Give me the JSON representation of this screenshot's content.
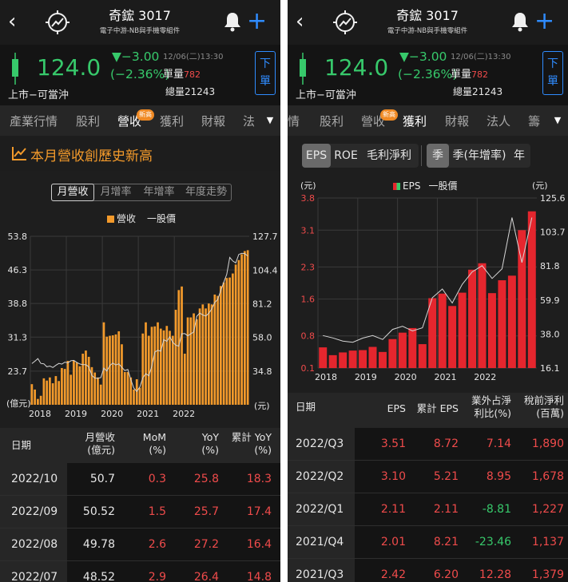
{
  "common": {
    "stock_title": "奇鋐 3017",
    "stock_subtitle": "電子中游-NB與手機零組件",
    "price": "124.0",
    "change": "▼−3.00",
    "change_pct": "(−2.36%)",
    "quote_time": "12/06(二)13:30",
    "unit_volume_label": "單量",
    "unit_volume": "782",
    "total_volume": "總量21243",
    "market": "上市−可當沖",
    "order_label": "下單",
    "icons": {
      "back": "back-chevron-icon",
      "logo": "trend-logo-icon",
      "bell": "bell-icon",
      "add": "plus-icon",
      "more": "dropdown-triangle-icon"
    },
    "colors": {
      "up": "#ef4b4b",
      "down": "#37c96b",
      "accent": "#f39a2b",
      "link": "#2f8cff"
    }
  },
  "left": {
    "tabs": [
      {
        "label": "產業行情"
      },
      {
        "label": "股利"
      },
      {
        "label": "營收",
        "badge": "新高",
        "active": true
      },
      {
        "label": "獲利"
      },
      {
        "label": "財報"
      },
      {
        "label": "法"
      }
    ],
    "banner": "本月營收創歷史新高",
    "segments": [
      "月營收",
      "月增率",
      "年增率",
      "年度走勢"
    ],
    "legend": {
      "bars": "營收",
      "line": "一股價"
    },
    "axis": {
      "left_ticks": [
        "53.8",
        "46.3",
        "38.8",
        "31.3",
        "23.7"
      ],
      "right_ticks": [
        "127.7",
        "104.4",
        "81.2",
        "58.0",
        "34.8"
      ],
      "left_unit": "(億元)",
      "right_unit": "(元)",
      "x_ticks": [
        "2018",
        "2019",
        "2020",
        "2021",
        "2022"
      ]
    },
    "table_headers": [
      "日期",
      "月營收\n(億元)",
      "MoM\n(%)",
      "YoY\n(%)",
      "累計 YoY\n(%)"
    ],
    "rows": [
      [
        "2022/10",
        "50.7",
        "0.3",
        "25.8",
        "18.3"
      ],
      [
        "2022/09",
        "50.52",
        "1.5",
        "25.7",
        "17.4"
      ],
      [
        "2022/08",
        "49.78",
        "2.6",
        "27.2",
        "16.4"
      ],
      [
        "2022/07",
        "48.52",
        "2.9",
        "26.4",
        "14.8"
      ]
    ]
  },
  "right": {
    "tabs": [
      {
        "label": "情"
      },
      {
        "label": "股利"
      },
      {
        "label": "營收",
        "badge": "新高"
      },
      {
        "label": "獲利",
        "active": true
      },
      {
        "label": "財報"
      },
      {
        "label": "法人"
      },
      {
        "label": "籌"
      }
    ],
    "seg_a": [
      "EPS",
      "ROE",
      "毛利淨利"
    ],
    "seg_b": [
      "季",
      "季(年增率)",
      "年"
    ],
    "legend": {
      "bars": "EPS",
      "line": "一股價"
    },
    "axis": {
      "left_unit": "(元)",
      "right_unit": "(元)",
      "left_ticks": [
        "3.8",
        "3.1",
        "2.3",
        "1.6",
        "0.8",
        "0.1"
      ],
      "right_ticks": [
        "125.6",
        "103.7",
        "81.8",
        "59.9",
        "38.0",
        "16.1"
      ],
      "x_ticks": [
        "2018",
        "2019",
        "2020",
        "2021",
        "2022"
      ]
    },
    "table_headers": [
      "日期",
      "EPS",
      "累計 EPS",
      "業外占淨\n利比(%)",
      "稅前淨利\n(百萬)"
    ],
    "rows": [
      [
        "2022/Q3",
        "3.51",
        "8.72",
        "7.14",
        "1,890"
      ],
      [
        "2022/Q2",
        "3.10",
        "5.21",
        "8.95",
        "1,678"
      ],
      [
        "2022/Q1",
        "2.11",
        "2.11",
        "-8.81",
        "1,227"
      ],
      [
        "2021/Q4",
        "2.01",
        "8.21",
        "-23.46",
        "1,137"
      ],
      [
        "2021/Q3",
        "2.42",
        "6.20",
        "12.28",
        "1,379"
      ]
    ]
  },
  "chart_data": [
    {
      "type": "bar",
      "title": "月營收",
      "ylabel": "(億元)",
      "y2label": "(元)",
      "ylim": [
        16.2,
        53.8
      ],
      "y2lim": [
        11.6,
        127.7
      ],
      "x_ticks": [
        "2018",
        "2019",
        "2020",
        "2021",
        "2022"
      ],
      "series": [
        {
          "name": "營收",
          "values": [
            20.8,
            19.6,
            17.5,
            18.2,
            22.1,
            21.6,
            22.3,
            21.0,
            22.6,
            21.5,
            24.4,
            24.2,
            26.0,
            22.9,
            26.0,
            25.6,
            24.8,
            27.6,
            28.3,
            26.9,
            24.6,
            23.4,
            22.3,
            20.7,
            34.6,
            31.4,
            31.6,
            31.7,
            31.9,
            32.6,
            29.7,
            23.5,
            23.5,
            22.3,
            19.6,
            21.9,
            20.0,
            32.1,
            34.6,
            31.6,
            33.6,
            33.7,
            34.6,
            33.2,
            32.8,
            33.8,
            32.7,
            31.6,
            37.4,
            41.8,
            42.6,
            27.6,
            35.7,
            35.7,
            36.6,
            35.3,
            37.7,
            38.6,
            37.7,
            38.8,
            38.6,
            40.8,
            40.5,
            42.7,
            43.5,
            44.5,
            44.6,
            45.5,
            47.5,
            48.5,
            49.8,
            50.5,
            50.7
          ]
        },
        {
          "name": "一股價",
          "values": [
            40.0,
            41.6,
            43.4,
            40.1,
            39.8,
            37.8,
            38.3,
            37.3,
            38.8,
            40.1,
            39.6,
            41.0,
            40.5,
            41.9,
            42.2,
            40.8,
            39.7,
            39.2,
            39.2,
            37.8,
            31.9,
            30.0,
            29.8,
            30.3,
            36.9,
            34.8,
            38.6,
            40.4,
            39.0,
            39.8,
            37.4,
            35.2,
            35.9,
            29.0,
            23.1,
            20.8,
            23.8,
            30.2,
            33.0,
            31.6,
            38.1,
            47.9,
            49.1,
            48.5,
            56.5,
            55.3,
            58.4,
            54.7,
            52.7,
            52.0,
            60.5,
            60.7,
            59.1,
            60.5,
            61.8,
            72.6,
            74.8,
            73.5,
            72.8,
            74.6,
            77.7,
            82.1,
            84.2,
            90.3,
            96.0,
            101.4,
            113.2,
            110.7,
            109.4,
            115.2,
            116.0,
            115.8,
            114.1
          ]
        }
      ]
    },
    {
      "type": "bar",
      "title": "EPS",
      "ylabel": "(元)",
      "y2label": "(元)",
      "ylim": [
        0.1,
        3.8
      ],
      "y2lim": [
        16.1,
        125.6
      ],
      "x_ticks": [
        "2018",
        "2019",
        "2020",
        "2021",
        "2022"
      ],
      "series": [
        {
          "name": "EPS",
          "values": [
            0.55,
            0.38,
            0.44,
            0.48,
            0.49,
            0.56,
            0.45,
            0.73,
            0.87,
            0.97,
            0.62,
            1.62,
            1.72,
            1.45,
            1.74,
            2.24,
            2.38,
            1.73,
            2.01,
            2.11,
            3.1,
            3.51
          ]
        },
        {
          "name": "一股價",
          "values": [
            37.0,
            35.5,
            33.5,
            32.7,
            35.4,
            37.0,
            34.5,
            41.0,
            43.0,
            40.0,
            42.0,
            61.4,
            67.0,
            58.0,
            70.0,
            78.0,
            82.0,
            73.8,
            80.0,
            113.0,
            84.0,
            113.0
          ]
        }
      ]
    }
  ]
}
